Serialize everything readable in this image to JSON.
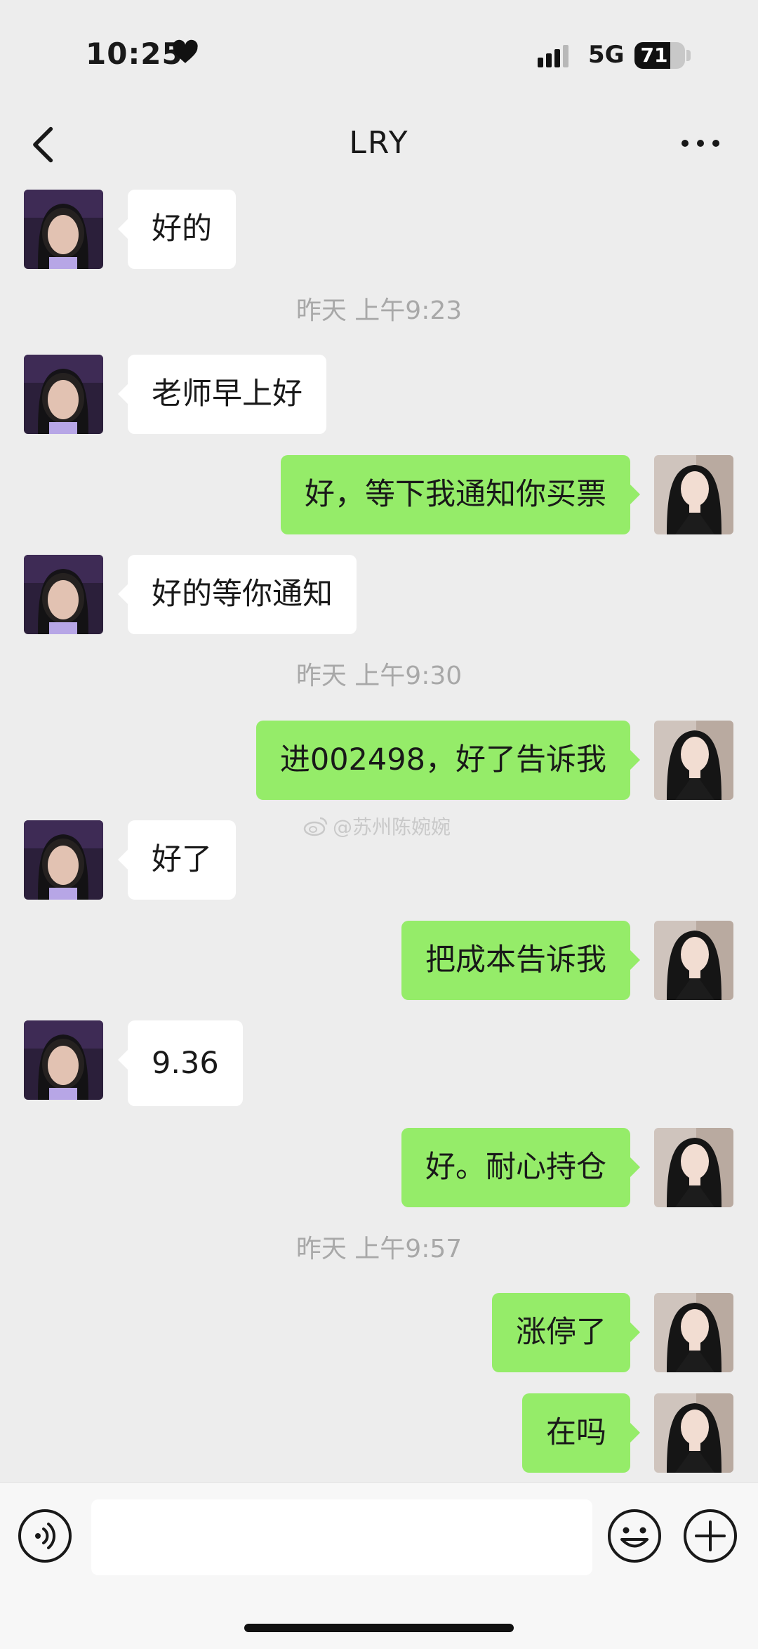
{
  "status_bar": {
    "time": "10:25",
    "network": "5G",
    "battery": "71",
    "battery_level": 0.71
  },
  "header": {
    "title": "LRY"
  },
  "messages": [
    {
      "side": "left",
      "text": "好的"
    },
    {
      "type": "time",
      "text": "昨天 上午9:23"
    },
    {
      "side": "left",
      "text": "老师早上好"
    },
    {
      "side": "right",
      "text": "好，等下我通知你买票"
    },
    {
      "side": "left",
      "text": "好的等你通知"
    },
    {
      "type": "time",
      "text": "昨天 上午9:30"
    },
    {
      "side": "right",
      "text": "进002498，好了告诉我"
    },
    {
      "side": "left",
      "text": "好了"
    },
    {
      "side": "right",
      "text": "把成本告诉我"
    },
    {
      "side": "left",
      "text": "9.36"
    },
    {
      "side": "right",
      "text": "好。耐心持仓"
    },
    {
      "type": "time",
      "text": "昨天 上午9:57"
    },
    {
      "side": "right",
      "text": "涨停了"
    },
    {
      "side": "right",
      "text": "在吗"
    }
  ],
  "watermark": "@苏州陈婉婉",
  "input_bar": {
    "placeholder": ""
  },
  "icons": {
    "back": "chevron-left-icon",
    "more": "more-dots-icon",
    "voice": "voice-icon",
    "emoji": "emoji-icon",
    "plus": "plus-icon"
  },
  "colors": {
    "background": "#ededed",
    "sent_bubble": "#95ec69",
    "received_bubble": "#ffffff",
    "timestamp": "#a8a8a8"
  }
}
